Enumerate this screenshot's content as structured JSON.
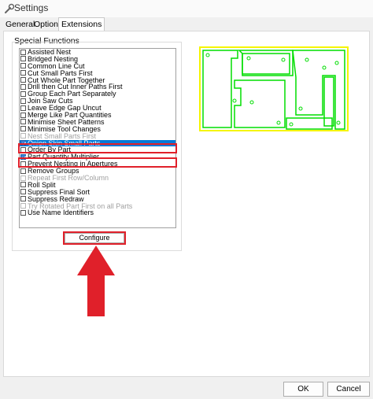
{
  "window": {
    "title": "Settings"
  },
  "tabs": [
    {
      "label": "General"
    },
    {
      "label": "Options"
    },
    {
      "label": "Extensions"
    }
  ],
  "special_functions": {
    "group_label": "Special Functions",
    "items": [
      {
        "label": "Assisted Nest",
        "checked": false,
        "disabled": false
      },
      {
        "label": "Bridged Nesting",
        "checked": false,
        "disabled": false
      },
      {
        "label": "Common Line Cut",
        "checked": false,
        "disabled": false
      },
      {
        "label": "Cut Small Parts First",
        "checked": false,
        "disabled": false
      },
      {
        "label": "Cut Whole Part Together",
        "checked": false,
        "disabled": false
      },
      {
        "label": "Drill then Cut Inner Paths First",
        "checked": false,
        "disabled": false
      },
      {
        "label": "Group Each Part Separately",
        "checked": false,
        "disabled": false
      },
      {
        "label": "Join Saw Cuts",
        "checked": false,
        "disabled": false
      },
      {
        "label": "Leave Edge Gap Uncut",
        "checked": false,
        "disabled": false
      },
      {
        "label": "Merge Like Part Quantities",
        "checked": false,
        "disabled": false
      },
      {
        "label": "Minimise Sheet Patterns",
        "checked": false,
        "disabled": false
      },
      {
        "label": "Minimise Tool Changes",
        "checked": false,
        "disabled": false
      },
      {
        "label": "Nest Small Parts First",
        "checked": false,
        "disabled": true
      },
      {
        "label": "Onion Skin Small Parts",
        "checked": true,
        "disabled": false,
        "selected": true
      },
      {
        "label": "Order By Part",
        "checked": false,
        "disabled": false
      },
      {
        "label": "Part Quantity Multiplier",
        "checked": true,
        "disabled": false
      },
      {
        "label": "Prevent Nesting in Apertures",
        "checked": false,
        "disabled": false
      },
      {
        "label": "Remove Groups",
        "checked": false,
        "disabled": false
      },
      {
        "label": "Repeat First Row/Column",
        "checked": false,
        "disabled": true
      },
      {
        "label": "Roll Split",
        "checked": false,
        "disabled": false
      },
      {
        "label": "Suppress Final Sort",
        "checked": false,
        "disabled": false
      },
      {
        "label": "Suppress Redraw",
        "checked": false,
        "disabled": false
      },
      {
        "label": "Try Rotated Part First on all Parts",
        "checked": false,
        "disabled": true
      },
      {
        "label": "Use Name Identifiers",
        "checked": false,
        "disabled": false
      }
    ]
  },
  "configure_label": "Configure",
  "buttons": {
    "ok": "OK",
    "cancel": "Cancel"
  },
  "colors": {
    "highlight_red": "#e0202a",
    "selection_blue": "#0078d7",
    "sheet_outline": "#f5f500",
    "part_outline": "#00dd00"
  },
  "icons": {
    "title": "wrench-icon",
    "arrow": "arrow-up-icon"
  }
}
